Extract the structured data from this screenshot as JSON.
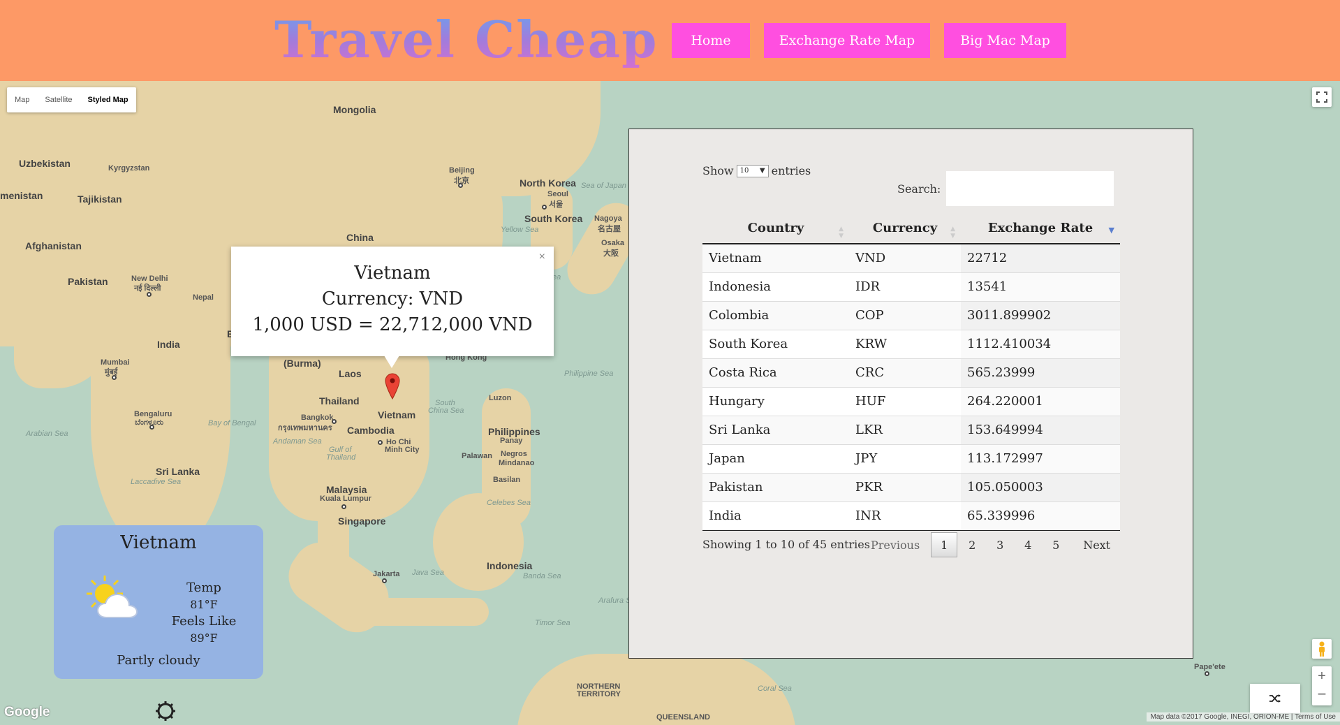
{
  "header": {
    "brand": "Travel Cheap",
    "nav": [
      {
        "label": "Home"
      },
      {
        "label": "Exchange Rate Map"
      },
      {
        "label": "Big Mac Map"
      }
    ]
  },
  "map": {
    "type_controls": [
      "Map",
      "Satellite",
      "Styled Map"
    ],
    "active_type": "Styled Map",
    "labels": {
      "mongolia": "Mongolia",
      "uzbekistan": "Uzbekistan",
      "kyrgyzstan": "Kyrgyzstan",
      "turkmenistan": "menistan",
      "tajikistan": "Tajikistan",
      "afghanistan": "Afghanistan",
      "pakistan": "Pakistan",
      "new_delhi": "New Delhi",
      "new_delhi_hi": "नई दिल्ली",
      "nepal": "Nepal",
      "india": "India",
      "mumbai": "Mumbai",
      "mumbai_mr": "मुंबई",
      "bengaluru": "Bengaluru",
      "bengaluru_kn": "ಬೆಂಗಳೂರು",
      "sri_lanka": "Sri Lanka",
      "china": "China",
      "beijing": "Beijing",
      "beijing_zh": "北京",
      "north_korea": "North Korea",
      "seoul": "Seoul",
      "seoul_ko": "서울",
      "south_korea": "South Korea",
      "nagoya": "Nagoya",
      "nagoya_ja": "名古屋",
      "osaka": "Osaka",
      "osaka_ja": "大阪",
      "burma": "(Burma)",
      "laos": "Laos",
      "hong_kong": "Hong Kong",
      "thailand": "Thailand",
      "bangkok": "Bangkok",
      "bangkok_th": "กรุงเทพมหานคร",
      "vietnam": "Vietnam",
      "cambodia": "Cambodia",
      "ho_chi_minh": "Ho Chi",
      "ho_chi_minh2": "Minh City",
      "philippines": "Philippines",
      "luzon": "Luzon",
      "panay": "Panay",
      "negros": "Negros",
      "mindanao": "Mindanao",
      "palawan": "Palawan",
      "basilan": "Basilan",
      "malaysia": "Malaysia",
      "kuala_lumpur": "Kuala Lumpur",
      "singapore": "Singapore",
      "indonesia": "Indonesia",
      "jakarta": "Jakarta",
      "b_label": "B",
      "northern_territory": "NORTHERN",
      "northern_territory2": "TERRITORY",
      "queensland": "QUEENSLAND",
      "papeete": "Pape'ete"
    },
    "seas": {
      "sea_of_japan": "Sea of Japan",
      "yellow_sea": "Yellow Sea",
      "philippine_sea": "Philippine Sea",
      "south_china_sea": "South",
      "south_china_sea2": "China Sea",
      "bay_of_bengal": "Bay of Bengal",
      "arabian_sea": "Arabian Sea",
      "andaman_sea": "Andaman Sea",
      "gulf_thailand": "Gulf of",
      "gulf_thailand2": "Thailand",
      "laccadive_sea": "Laccadive Sea",
      "celebes_sea": "Celebes Sea",
      "java_sea": "Java Sea",
      "banda_sea": "Banda Sea",
      "arafura_sea": "Arafura S",
      "timor_sea": "Timor Sea",
      "coral_sea": "Coral Sea",
      "ea": "ea"
    },
    "google_logo": "Google",
    "attribution": "Map data ©2017 Google, INEGI, ORION-ME  |  Terms of Use"
  },
  "popup": {
    "country": "Vietnam",
    "currency_line": "Currency: VND",
    "rate_line": "1,000 USD = 22,712,000 VND",
    "close": "×"
  },
  "weather": {
    "location": "Vietnam",
    "temp_label": "Temp",
    "temp_value": "81°F",
    "feels_label": "Feels Like",
    "feels_value": "89°F",
    "description": "Partly cloudy",
    "icon": "partly-cloudy-icon"
  },
  "table": {
    "show_label": "Show",
    "entries_label": "entries",
    "page_size": "10",
    "search_label": "Search:",
    "search_value": "",
    "columns": [
      "Country",
      "Currency",
      "Exchange Rate"
    ],
    "rows": [
      [
        "Vietnam",
        "VND",
        "22712"
      ],
      [
        "Indonesia",
        "IDR",
        "13541"
      ],
      [
        "Colombia",
        "COP",
        "3011.899902"
      ],
      [
        "South Korea",
        "KRW",
        "1112.410034"
      ],
      [
        "Costa Rica",
        "CRC",
        "565.23999"
      ],
      [
        "Hungary",
        "HUF",
        "264.220001"
      ],
      [
        "Sri Lanka",
        "LKR",
        "153.649994"
      ],
      [
        "Japan",
        "JPY",
        "113.172997"
      ],
      [
        "Pakistan",
        "PKR",
        "105.050003"
      ],
      [
        "India",
        "INR",
        "65.339996"
      ]
    ],
    "info": "Showing 1 to 10 of 45 entries",
    "pagination": {
      "previous": "Previous",
      "pages": [
        "1",
        "2",
        "3",
        "4",
        "5"
      ],
      "current": "1",
      "next": "Next"
    }
  },
  "colors": {
    "header_bg": "#fd9966",
    "nav_bg": "#ff4fe0",
    "water": "#b8d3c3",
    "land": "#e6d3a6",
    "weather_bg": "#95b3e3",
    "panel_bg": "#ebe9e7"
  }
}
